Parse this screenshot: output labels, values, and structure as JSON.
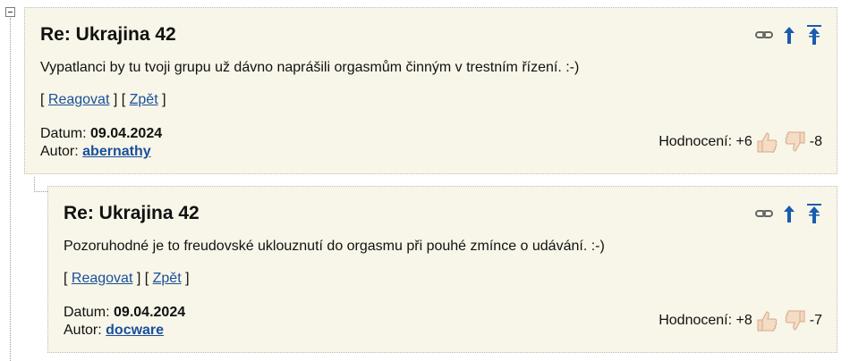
{
  "comments": [
    {
      "title": "Re: Ukrajina 42",
      "body": "Vypatlanci by tu tvoji grupu už dávno naprášili orgasmům činným v trestním řízení. :-)",
      "reply_label": "Reagovat",
      "back_label": "Zpět",
      "date_label": "Datum:",
      "date": "09.04.2024",
      "author_label": "Autor:",
      "author": "abernathy",
      "rating_label": "Hodnocení:",
      "rating_up": "+6",
      "rating_down": "-8"
    },
    {
      "title": "Re: Ukrajina 42",
      "body": "Pozoruhodné je to freudovské uklouznutí do orgasmu při pouhé zmínce o udávání. :-)",
      "reply_label": "Reagovat",
      "back_label": "Zpět",
      "date_label": "Datum:",
      "date": "09.04.2024",
      "author_label": "Autor:",
      "author": "docware",
      "rating_label": "Hodnocení:",
      "rating_up": "+8",
      "rating_down": "-7"
    }
  ],
  "icons": [
    "link-icon",
    "arrow-up-icon",
    "arrow-top-icon",
    "thumb-up-icon",
    "thumb-down-icon",
    "collapse-icon"
  ],
  "colors": {
    "accent": "#1a4f9c",
    "panel_bg": "#f8f6e8"
  }
}
